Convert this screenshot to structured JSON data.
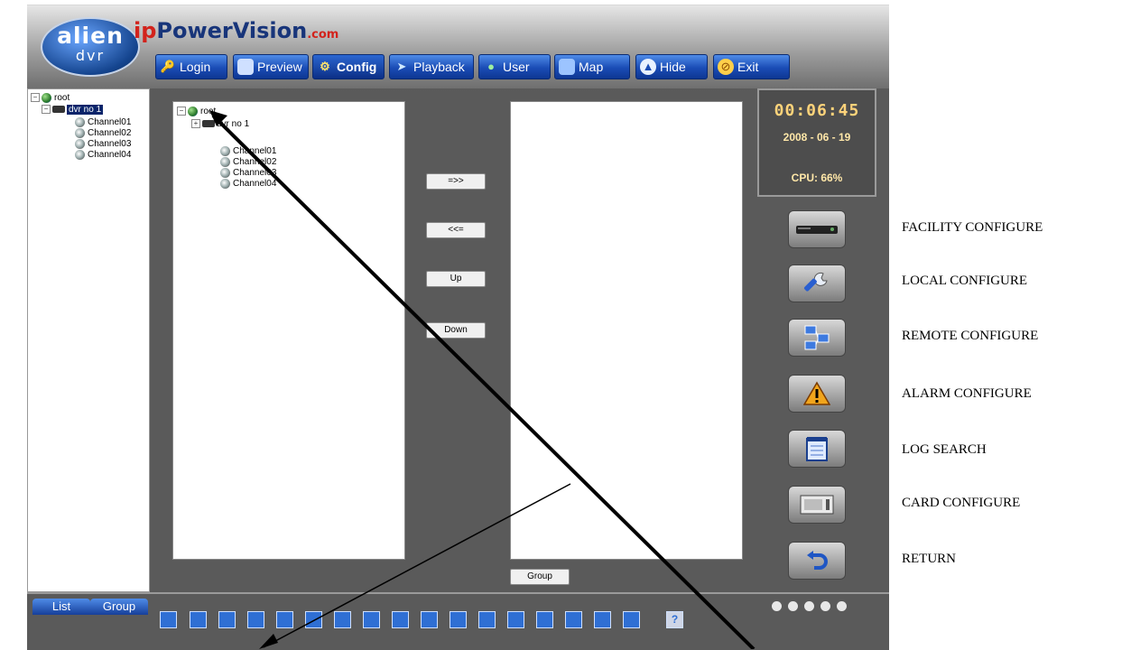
{
  "header": {
    "logo_line1": "alien",
    "logo_line2": "dvr",
    "brand_ip": "ip",
    "brand_main": "PowerVision",
    "brand_com": ".com",
    "nav": [
      "Login",
      "Preview",
      "Config",
      "Playback",
      "User",
      "Map",
      "Hide",
      "Exit"
    ],
    "active": "Config"
  },
  "left_tree": {
    "root": "root",
    "dvr": "dvr no 1",
    "channels": [
      "Channel01",
      "Channel02",
      "Channel03",
      "Channel04"
    ]
  },
  "center_tree": {
    "root": "root",
    "dvr": "dvr no 1",
    "channels": [
      "Channel01",
      "Channel02",
      "Channel03",
      "Channel04"
    ]
  },
  "buttons": {
    "add": "=>>",
    "remove": "<<=",
    "up": "Up",
    "down": "Down",
    "group": "Group"
  },
  "status": {
    "time": "00:06:45",
    "date": "2008 - 06 - 19",
    "cpu": "CPU: 66%"
  },
  "tabs": [
    "List",
    "Group"
  ],
  "side_labels": [
    "FACILITY CONFIGURE",
    "LOCAL CONFIGURE",
    "REMOTE CONFIGURE",
    "ALARM CONFIGURE",
    "LOG SEARCH",
    "CARD CONFIGURE",
    "RETURN"
  ],
  "icons": {
    "side": [
      "dvr-device-icon",
      "wrench-icon",
      "network-icon",
      "alarm-warning-icon",
      "notepad-icon",
      "card-icon",
      "return-arrow-icon"
    ]
  },
  "colors": {
    "accent": "#1a4cb5",
    "panel": "#5a5a5a",
    "clock_text": "#ffd37a"
  }
}
